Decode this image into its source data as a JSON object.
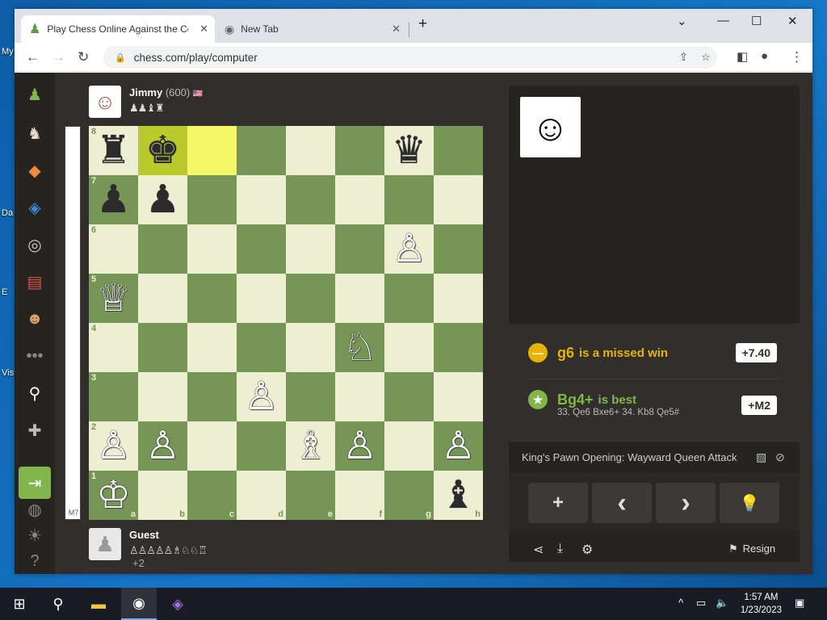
{
  "desktop": {
    "labels": [
      "My",
      "Da",
      "E",
      "Vis"
    ]
  },
  "browser": {
    "tabs": [
      {
        "title": "Play Chess Online Against the Co",
        "active": true
      },
      {
        "title": "New Tab",
        "active": false
      }
    ],
    "new_tab": "+",
    "url": "chess.com/play/computer"
  },
  "sidebar": {
    "icons": [
      "pawn-logo-icon",
      "puzzle-icon",
      "lessons-icon",
      "learn-icon",
      "watch-icon",
      "news-icon",
      "social-icon",
      "more-icon",
      "search-icon",
      "add-user-icon",
      "login-icon",
      "globe-icon",
      "theme-icon",
      "help-icon"
    ]
  },
  "top_player": {
    "name": "Jimmy",
    "rating": "(600)",
    "flag": "🇺🇸",
    "captured": "♟♟♝♜"
  },
  "bottom_player": {
    "name": "Guest",
    "captured": "♙♙♙♙♙♗♘♘♖",
    "material": "+2"
  },
  "eval": {
    "text": "M7"
  },
  "board": {
    "ranks": [
      "8",
      "7",
      "6",
      "5",
      "4",
      "3",
      "2",
      "1"
    ],
    "files": [
      "a",
      "b",
      "c",
      "d",
      "e",
      "f",
      "g",
      "h"
    ],
    "highlight_squares": [
      "b8",
      "c8"
    ],
    "pieces": {
      "a8": "♜",
      "b8": "♚",
      "g8": "♛",
      "a7": "♟",
      "b7": "♟",
      "g6": "♙",
      "a5": "♕",
      "f4": "♘",
      "d3": "♙",
      "a2": "♙",
      "b2": "♙",
      "e2": "♗",
      "f2": "♙",
      "h2": "♙",
      "a1": "♔",
      "h1": "♝"
    },
    "white_pieces": [
      "g6",
      "a5",
      "f4",
      "d3",
      "a2",
      "b2",
      "e2",
      "f2",
      "h2",
      "a1"
    ]
  },
  "coach": {
    "missed": {
      "move": "g6",
      "text": "is a missed win",
      "score": "+7.40",
      "color": "#e6b400"
    },
    "best": {
      "move": "Bg4+",
      "text": "is best",
      "score": "+M2",
      "color": "#81b64c",
      "variation": "33. Qe6 Bxe6+ 34. Kb8 Qe5#"
    }
  },
  "opening": "King's Pawn Opening: Wayward Queen Attack",
  "controls": {
    "add": "+",
    "prev": "‹",
    "next": "›",
    "hint": "💡"
  },
  "footer": {
    "resign": "Resign"
  },
  "taskbar": {
    "time": "1:57 AM",
    "date": "1/23/2023"
  }
}
